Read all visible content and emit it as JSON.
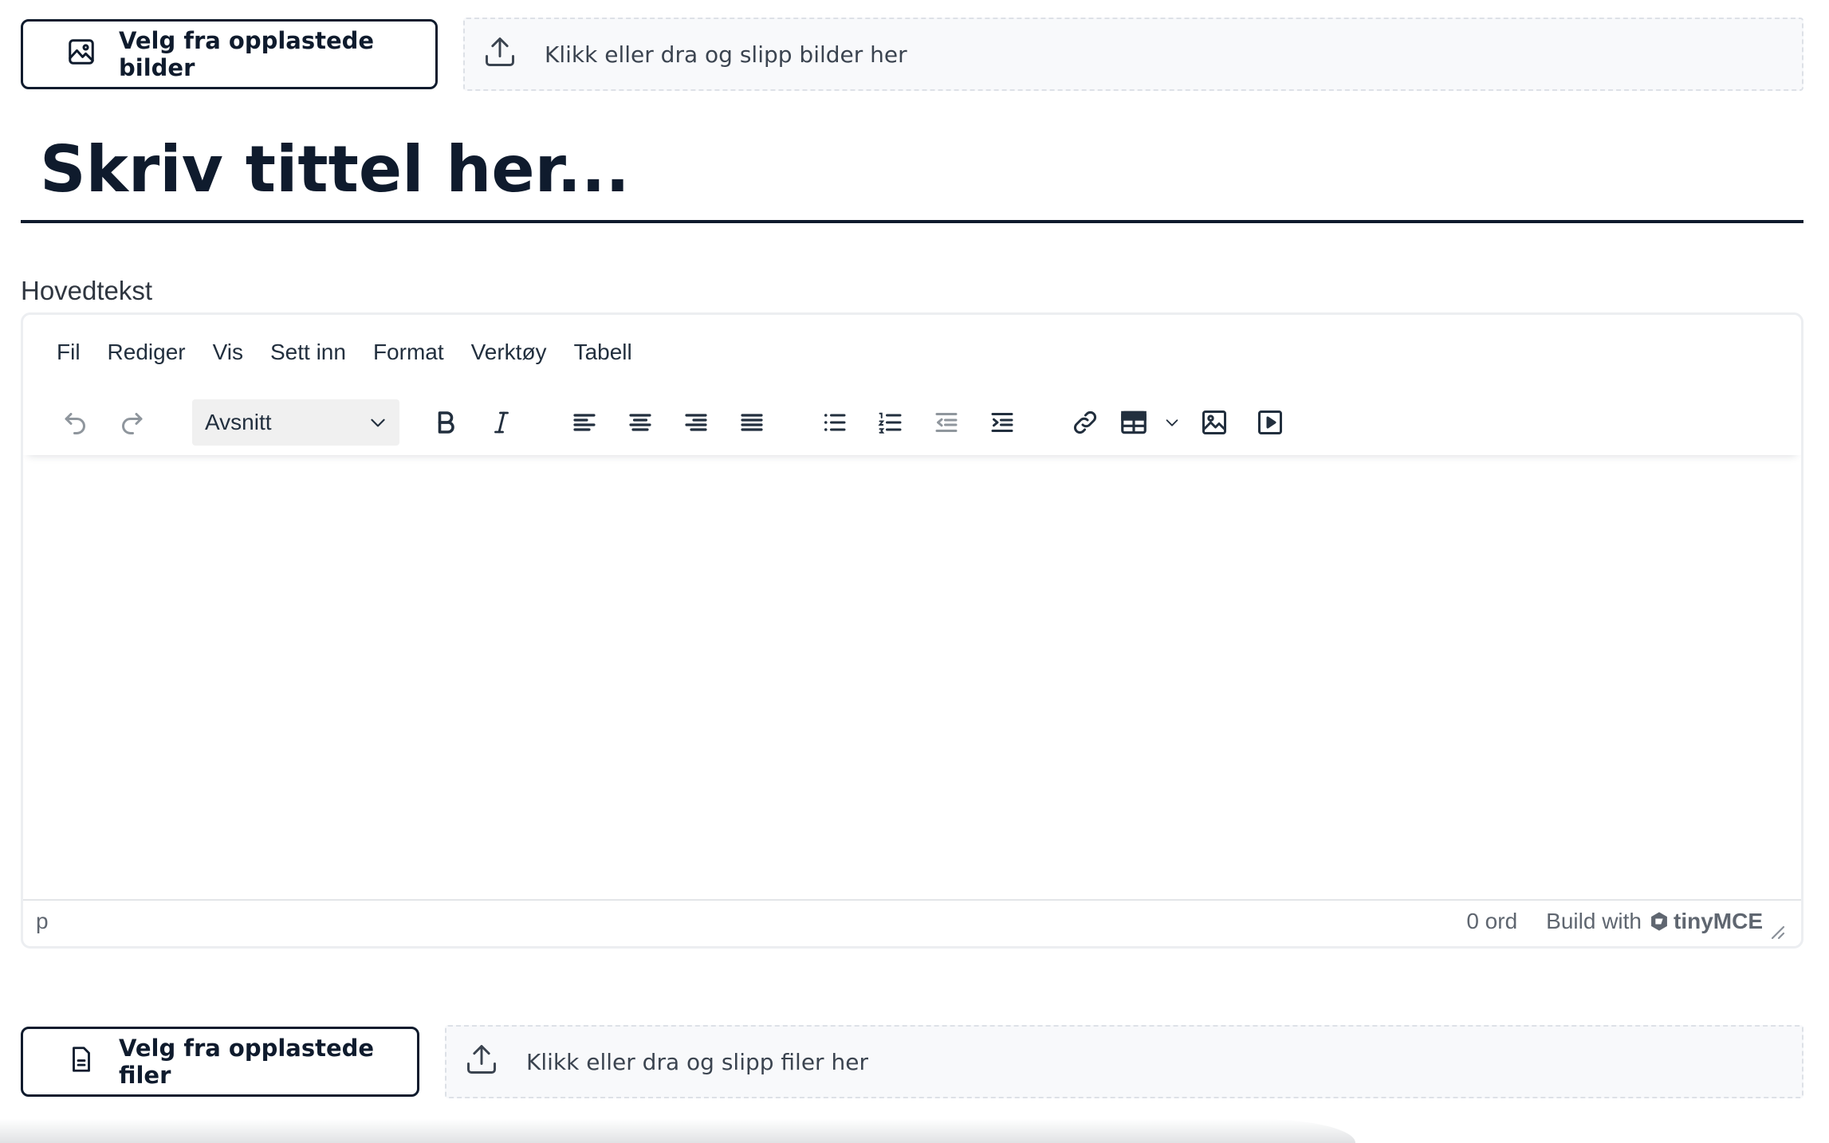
{
  "image_upload": {
    "button_label": "Velg fra opplastede bilder",
    "dropzone_text": "Klikk eller dra og slipp bilder her"
  },
  "title": {
    "placeholder": "Skriv tittel her..."
  },
  "body_label": "Hovedtekst",
  "editor": {
    "menubar": [
      "Fil",
      "Rediger",
      "Vis",
      "Sett inn",
      "Format",
      "Verktøy",
      "Tabell"
    ],
    "blocks_value": "Avsnitt",
    "status_path": "p",
    "wordcount": "0 ord",
    "branding_prefix": "Build with",
    "branding_name": "tinyMCE"
  },
  "file_upload": {
    "button_label": "Velg fra opplastede filer",
    "dropzone_text": "Klikk eller dra og slipp filer her"
  }
}
